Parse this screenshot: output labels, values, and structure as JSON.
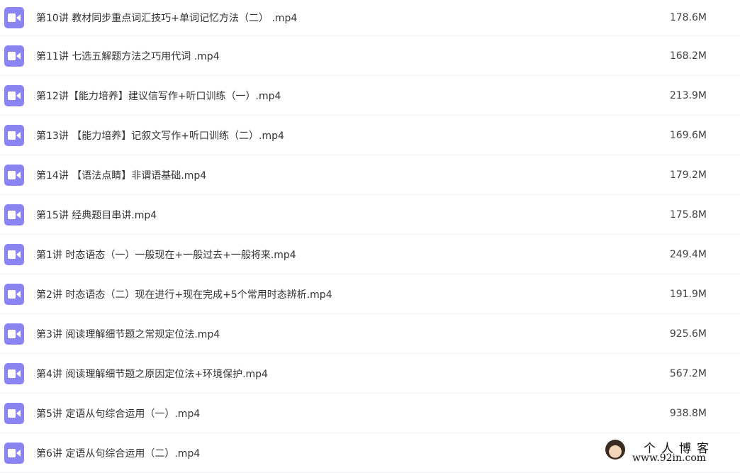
{
  "icon_color": "#8a84f3",
  "files": [
    {
      "name": "第10讲 教材同步重点词汇技巧+单词记忆方法（二） .mp4",
      "size": "178.6M",
      "icon": "video-file-icon"
    },
    {
      "name": "第11讲 七选五解题方法之巧用代词 .mp4",
      "size": "168.2M",
      "icon": "video-file-icon"
    },
    {
      "name": "第12讲【能力培养】建议信写作+听口训练（一）.mp4",
      "size": "213.9M",
      "icon": "video-file-icon"
    },
    {
      "name": "第13讲 【能力培养】记叙文写作+听口训练（二）.mp4",
      "size": "169.6M",
      "icon": "video-file-icon"
    },
    {
      "name": "第14讲 【语法点睛】非谓语基础.mp4",
      "size": "179.2M",
      "icon": "video-file-icon"
    },
    {
      "name": "第15讲 经典题目串讲.mp4",
      "size": "175.8M",
      "icon": "video-file-icon"
    },
    {
      "name": "第1讲 时态语态（一）一般现在+一般过去+一般将来.mp4",
      "size": "249.4M",
      "icon": "video-file-icon"
    },
    {
      "name": "第2讲 时态语态（二）现在进行+现在完成+5个常用时态辨析.mp4",
      "size": "191.9M",
      "icon": "video-file-icon"
    },
    {
      "name": "第3讲 阅读理解细节题之常规定位法.mp4",
      "size": "925.6M",
      "icon": "video-file-icon"
    },
    {
      "name": "第4讲 阅读理解细节题之原因定位法+环境保护.mp4",
      "size": "567.2M",
      "icon": "video-file-icon"
    },
    {
      "name": "第5讲 定语从句综合运用（一）.mp4",
      "size": "938.8M",
      "icon": "video-file-icon"
    },
    {
      "name": "第6讲 定语从句综合运用（二）.mp4",
      "size": "",
      "icon": "video-file-icon"
    }
  ],
  "watermark": {
    "title": "个人博客",
    "url": "www.92in.com"
  }
}
